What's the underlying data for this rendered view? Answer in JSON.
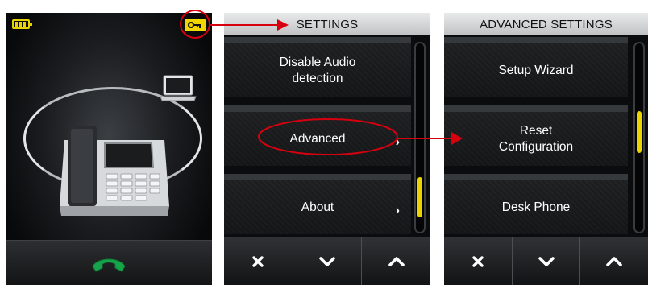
{
  "screen_home": {
    "battery_icon": "battery-full-icon",
    "key_icon": "key-icon",
    "laptop_icon": "laptop-icon",
    "desk_phone_icon": "desk-phone-icon",
    "call_icon": "phone-handset-icon",
    "accent_color": "#f2d600",
    "call_color": "#17a34a"
  },
  "settings": {
    "title": "SETTINGS",
    "items": [
      {
        "label": "Disable Audio detection",
        "has_chevron": false
      },
      {
        "label": "Advanced",
        "has_chevron": true,
        "chevron": "›"
      },
      {
        "label": "About",
        "has_chevron": true,
        "chevron": "›"
      }
    ],
    "scroll_position": 0.85,
    "buttons": [
      "close-icon",
      "chevron-down-icon",
      "chevron-up-icon"
    ]
  },
  "advanced_settings": {
    "title": "ADVANCED SETTINGS",
    "items": [
      {
        "label": "Setup Wizard"
      },
      {
        "label": "Reset Configuration"
      },
      {
        "label": "Desk Phone"
      }
    ],
    "scroll_position": 0.5,
    "buttons": [
      "close-icon",
      "chevron-down-icon",
      "chevron-up-icon"
    ]
  },
  "annotation_color": "#d7000f",
  "scrollbar_thumb_color": "#e9d400"
}
